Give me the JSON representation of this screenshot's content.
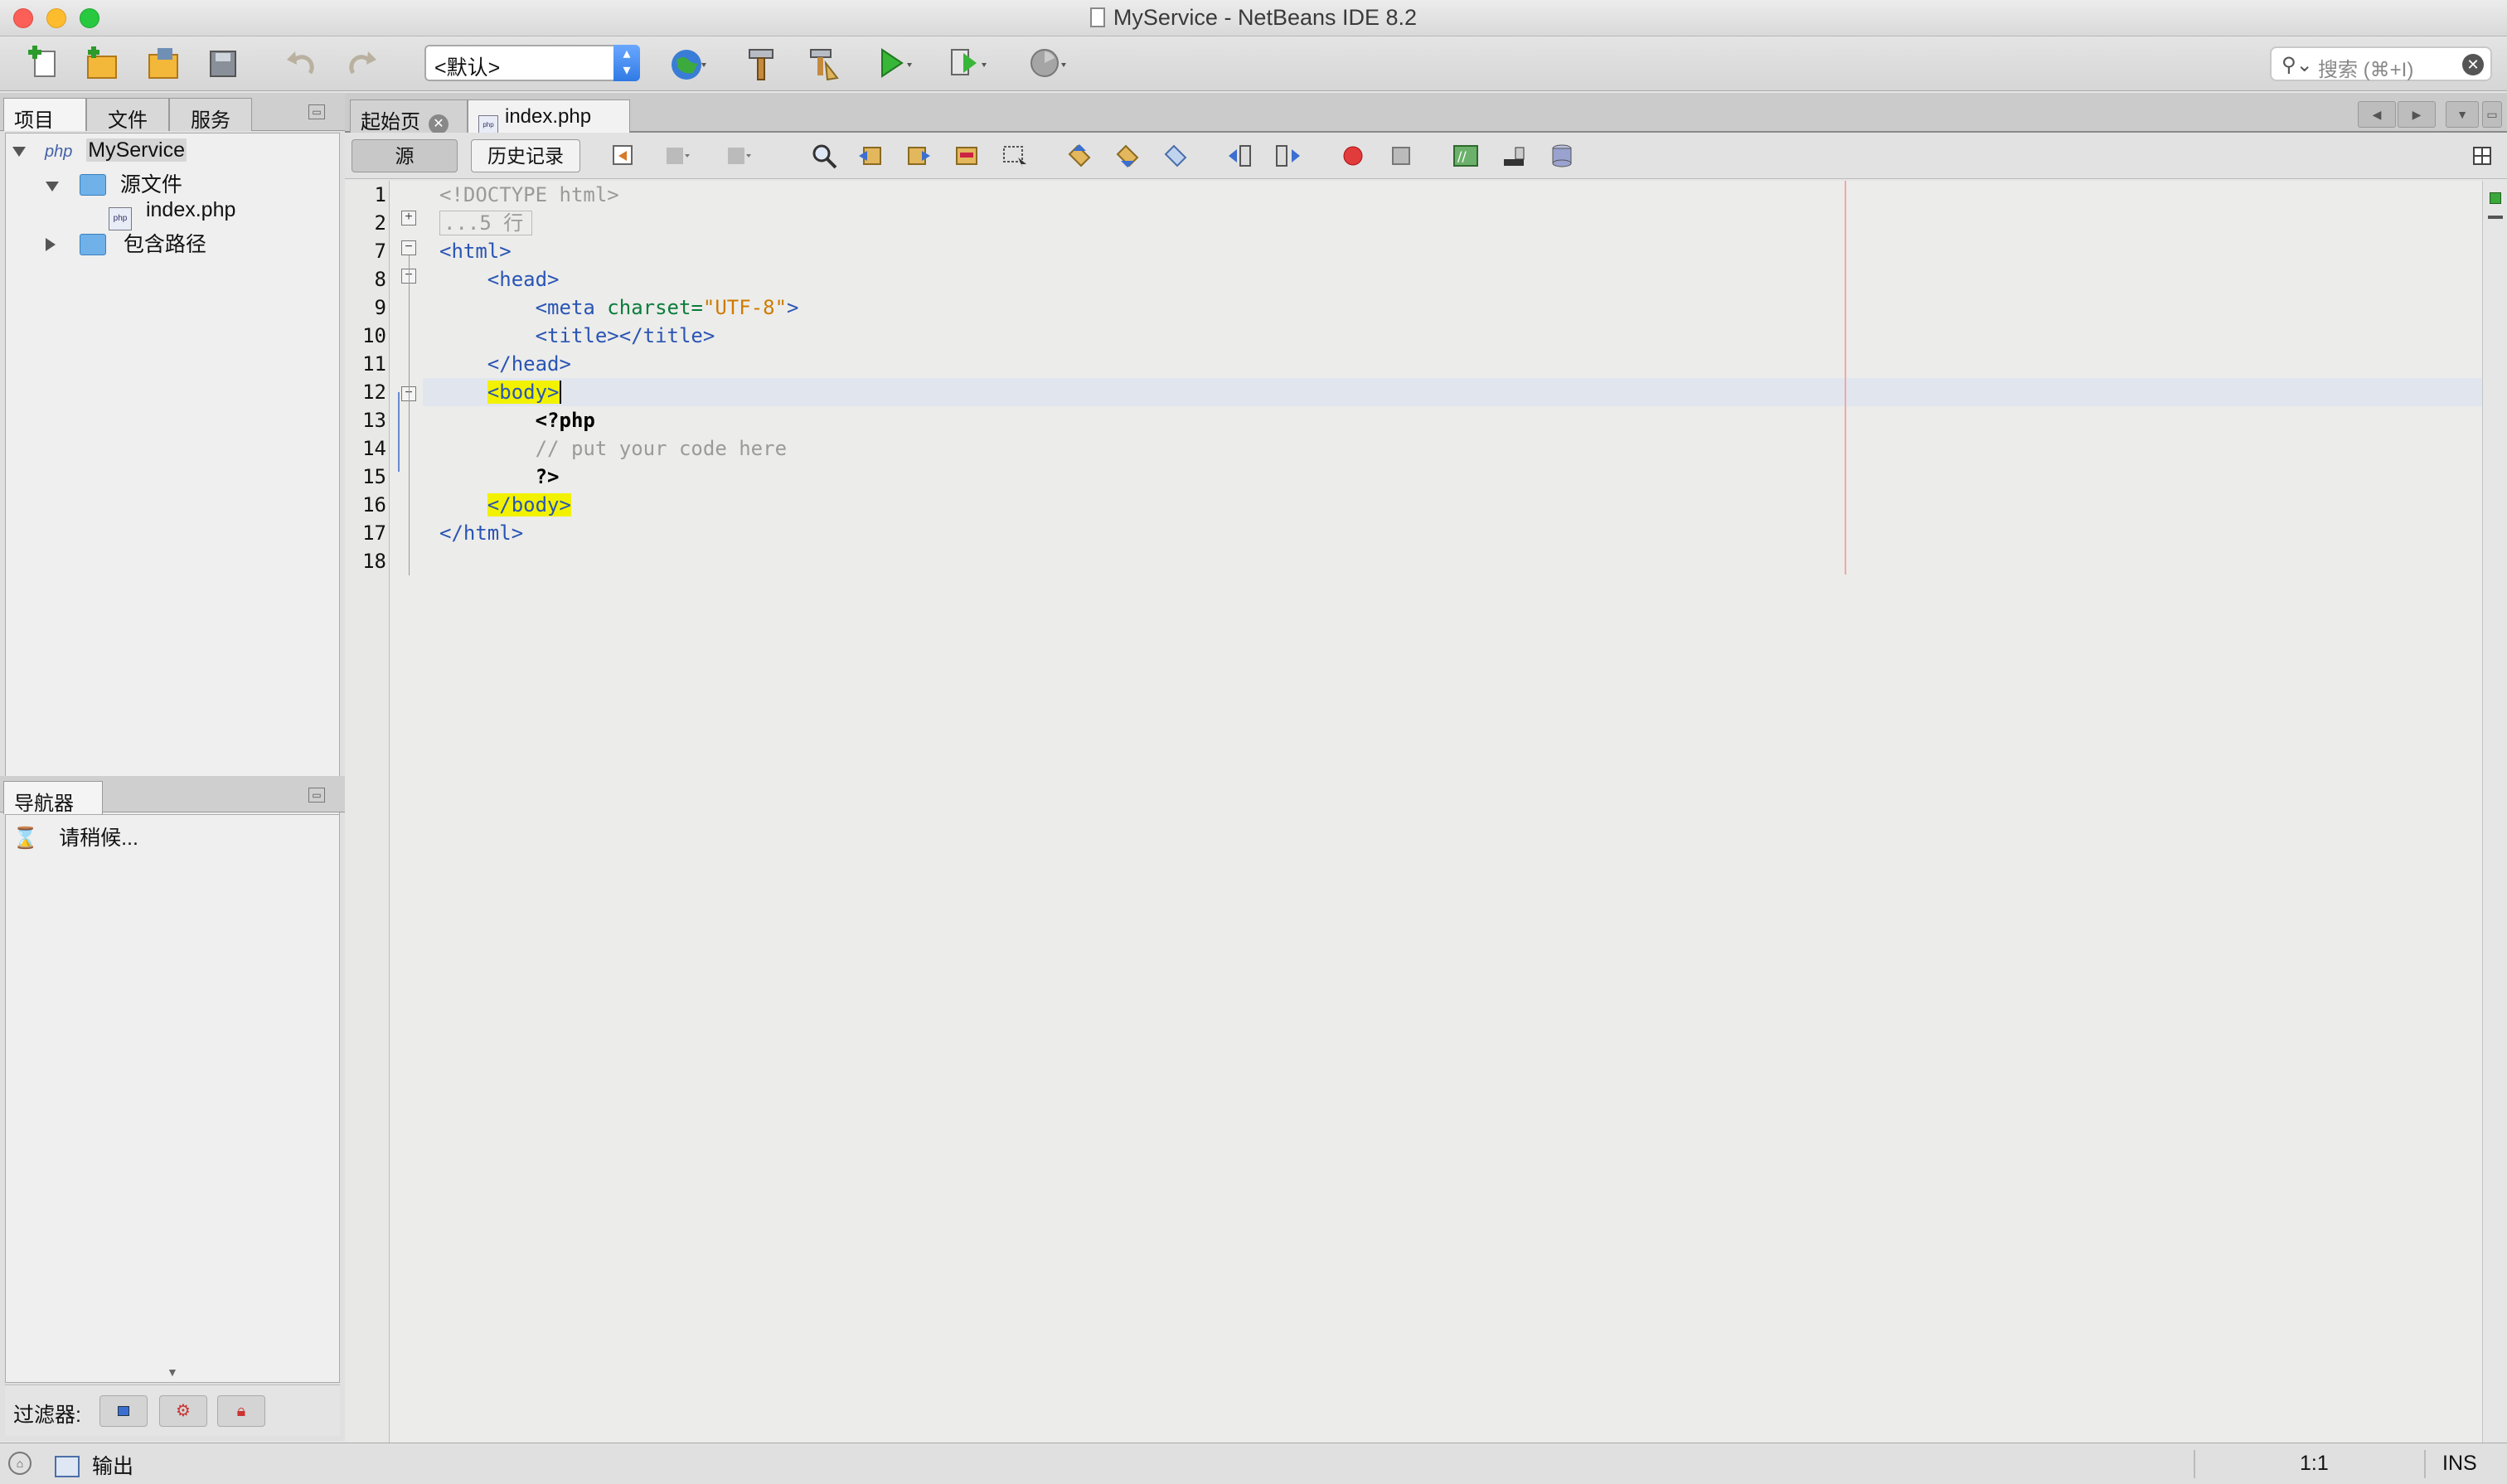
{
  "window": {
    "title": "MyService - NetBeans IDE 8.2"
  },
  "toolbar": {
    "config_select": "<默认>",
    "search_placeholder": "搜索 (⌘+I)",
    "icons": [
      "new-file-icon",
      "new-project-icon",
      "open-project-icon",
      "save-all-icon",
      "undo-icon",
      "redo-icon",
      "browser-globe-icon",
      "build-hammer-icon",
      "clean-build-icon",
      "run-icon",
      "debug-icon",
      "profile-icon"
    ]
  },
  "left_panel": {
    "tabs": [
      "项目",
      "文件",
      "服务"
    ],
    "tree": {
      "project": "MyService",
      "source_folder": "源文件",
      "file": "index.php",
      "include_path": "包含路径"
    },
    "navigator": {
      "tab": "导航器",
      "status": "请稍候..."
    },
    "filter_label": "过滤器:"
  },
  "editor": {
    "tabs": [
      "起始页",
      "index.php"
    ],
    "view_buttons": [
      "源",
      "历史记录"
    ],
    "code_lines": [
      {
        "n": "1",
        "html": "<span class=\"cmt\">&lt;!DOCTYPE html&gt;</span>"
      },
      {
        "n": "2",
        "html": "<span class=\"cmt\" style=\"border:1px solid #bbb;padding:0 10px 0 4px;\">...5 行</span>"
      },
      {
        "n": "7",
        "html": "<span class=\"tag\">&lt;html&gt;</span>"
      },
      {
        "n": "8",
        "html": "    <span class=\"tag\">&lt;head&gt;</span>"
      },
      {
        "n": "9",
        "html": "        <span class=\"tag\">&lt;meta </span><span class=\"attr\">charset=</span><span class=\"val\">\"UTF-8\"</span><span class=\"tag\">&gt;</span>"
      },
      {
        "n": "10",
        "html": "        <span class=\"tag\">&lt;title&gt;&lt;/title&gt;</span>"
      },
      {
        "n": "11",
        "html": "    <span class=\"tag\">&lt;/head&gt;</span>"
      },
      {
        "n": "12",
        "html": "    <span class=\"tag hl\">&lt;body&gt;</span><span style=\"border-left:2px solid #000;\"></span>"
      },
      {
        "n": "13",
        "html": "        <span class=\"kw\">&lt;?php</span>"
      },
      {
        "n": "14",
        "html": "        <span class=\"cmt\">// put your code here</span>"
      },
      {
        "n": "15",
        "html": "        <span class=\"kw\">?&gt;</span>"
      },
      {
        "n": "16",
        "html": "    <span class=\"tag hl\">&lt;/body&gt;</span>"
      },
      {
        "n": "17",
        "html": "<span class=\"tag\">&lt;/html&gt;</span>"
      },
      {
        "n": "18",
        "html": ""
      }
    ]
  },
  "statusbar": {
    "output_label": "输出",
    "position": "1:1",
    "mode": "INS"
  }
}
